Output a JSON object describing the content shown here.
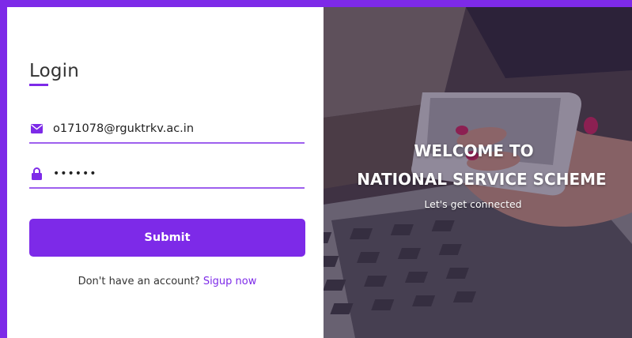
{
  "colors": {
    "accent": "#7d2ae8",
    "text": "#333333",
    "white": "#ffffff"
  },
  "login": {
    "title": "Login",
    "email": {
      "icon": "envelope-icon",
      "value": "o171078@rguktrkv.ac.in"
    },
    "password": {
      "icon": "lock-icon",
      "value": "••••••"
    },
    "submit_label": "Submit",
    "signup_prompt": "Don't have an account?",
    "signup_link": "Sigup now"
  },
  "hero": {
    "line1": "WELCOME TO",
    "line2": "NATIONAL SERVICE SCHEME",
    "subtitle": "Let's get connected"
  }
}
